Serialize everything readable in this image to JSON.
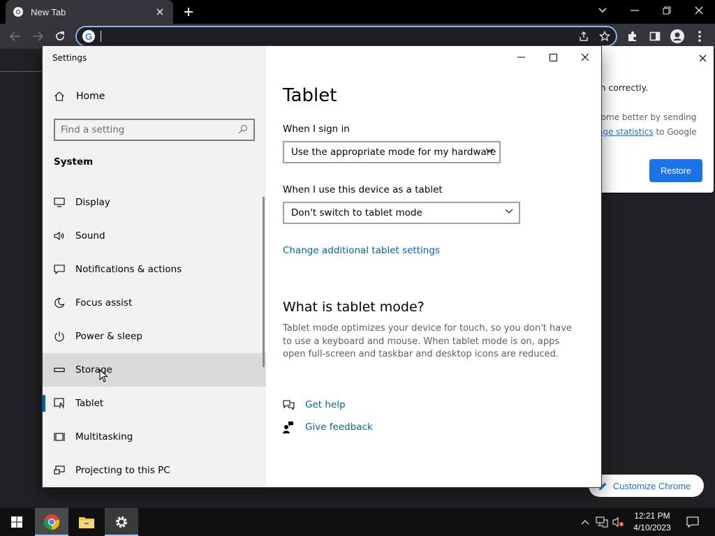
{
  "browser": {
    "tab_title": "New Tab",
    "address_value": "",
    "icons": [
      "chrome-logo-icon",
      "close-icon",
      "plus-icon",
      "chevron-down-icon",
      "minimize-icon",
      "restore-icon",
      "back-icon",
      "forward-icon",
      "reload-icon",
      "google-icon",
      "share-icon",
      "star-icon",
      "extensions-icon",
      "side-panel-icon",
      "profile-icon",
      "kebab-menu-icon"
    ]
  },
  "chrome_page": {
    "sync_card": {
      "line1": "in correctly.",
      "line2": "rome better by sending",
      "line3_link": "age statistics",
      "line3_suffix": " to Google",
      "restore_label": "Restore"
    },
    "customize_label": "Customize Chrome"
  },
  "settings": {
    "app_title": "Settings",
    "home_label": "Home",
    "search_placeholder": "Find a setting",
    "section_label": "System",
    "nav_items": [
      {
        "label": "Display",
        "icon": "display-icon"
      },
      {
        "label": "Sound",
        "icon": "speaker-icon"
      },
      {
        "label": "Notifications & actions",
        "icon": "notification-icon"
      },
      {
        "label": "Focus assist",
        "icon": "moon-icon"
      },
      {
        "label": "Power & sleep",
        "icon": "power-icon"
      },
      {
        "label": "Storage",
        "icon": "storage-icon",
        "state": "hover"
      },
      {
        "label": "Tablet",
        "icon": "tablet-icon",
        "state": "selected"
      },
      {
        "label": "Multitasking",
        "icon": "multitasking-icon"
      },
      {
        "label": "Projecting to this PC",
        "icon": "projecting-icon"
      }
    ],
    "main": {
      "title": "Tablet",
      "sign_in_label": "When I sign in",
      "sign_in_value": "Use the appropriate mode for my hardware",
      "tablet_use_label": "When I use this device as a tablet",
      "tablet_use_value": "Don't switch to tablet mode",
      "additional_link": "Change additional tablet settings",
      "what_heading": "What is tablet mode?",
      "what_desc": "Tablet mode optimizes your device for touch, so you don't have to use a keyboard and mouse. When tablet mode is on, apps open full-screen and taskbar and desktop icons are reduced.",
      "get_help": "Get help",
      "give_feedback": "Give feedback"
    }
  },
  "taskbar": {
    "pinned": [
      "windows-start-icon",
      "chrome-icon",
      "file-explorer-icon",
      "settings-gear-icon"
    ],
    "time": "12:21 PM",
    "date": "4/10/2023"
  },
  "colors": {
    "accent_blue": "#0063b1",
    "chrome_blue": "#1a73e8",
    "nav_bg": "#f2f2f2",
    "hover_bg": "#dadada"
  }
}
